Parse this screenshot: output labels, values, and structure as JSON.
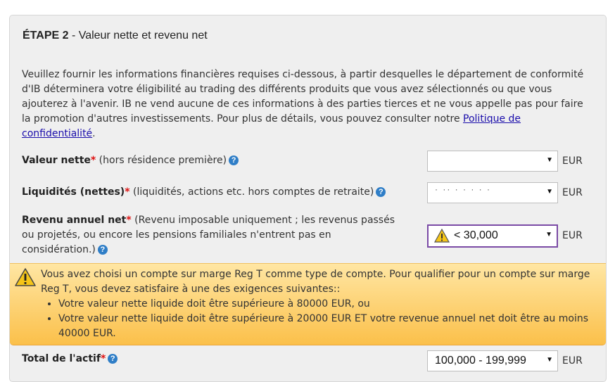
{
  "step": {
    "number_label": "ÉTAPE 2",
    "separator": " - ",
    "title": "Valeur nette et revenu net"
  },
  "intro": {
    "text": "Veuillez fournir les informations financières requises ci-dessous, à partir desquelles le département de conformité d'IB déterminera votre éligibilité au trading des différents produits que vous avez sélectionnés ou que vous ajouterez à l'avenir. IB ne vend aucune de ces informations à des parties tierces et ne vous appelle pas pour faire la promotion d'autres investissements. Pour plus de détails, vous pouvez consulter notre ",
    "link": "Politique de confidentialité",
    "end": "."
  },
  "fields": {
    "net_worth": {
      "label": "Valeur nette",
      "required": "*",
      "note": " (hors résidence première)",
      "value": "",
      "unit": "EUR"
    },
    "liquid": {
      "label": "Liquidités (nettes)",
      "required": "*",
      "note": " (liquidités, actions etc. hors comptes de retraite)",
      "value": "·  ·· ·  ·    ·   ·  ·",
      "unit": "EUR"
    },
    "income": {
      "label": "Revenu annuel net",
      "required": "*",
      "note": " (Revenu imposable uniquement ; les revenus passés ou projetés, ou encore les pensions familiales n'entrent pas en considération.)",
      "value": "< 30,000",
      "unit": "EUR"
    },
    "total": {
      "label": "Total de l'actif",
      "required": "*",
      "value": "100,000 - 199,999",
      "unit": "EUR"
    }
  },
  "alert": {
    "intro": "Vous avez choisi un compte sur marge Reg T comme type de compte. Pour qualifier pour un compte sur marge Reg T, vous devez satisfaire à une des exigences suivantes::",
    "items": [
      "Votre valeur nette liquide doit être supérieure à 80000 EUR, ou",
      "Votre valeur nette liquide doit être supérieure à 20000 EUR ET votre revenue annuel net doit être au moins 40000 EUR."
    ]
  },
  "icons": {
    "help": "question-icon",
    "warning": "warning-triangle-icon"
  },
  "colors": {
    "panel_bg": "#efefef",
    "alert_bg": "#fbc04a",
    "help_blue": "#2f7ec7",
    "required_red": "#dd1111"
  }
}
